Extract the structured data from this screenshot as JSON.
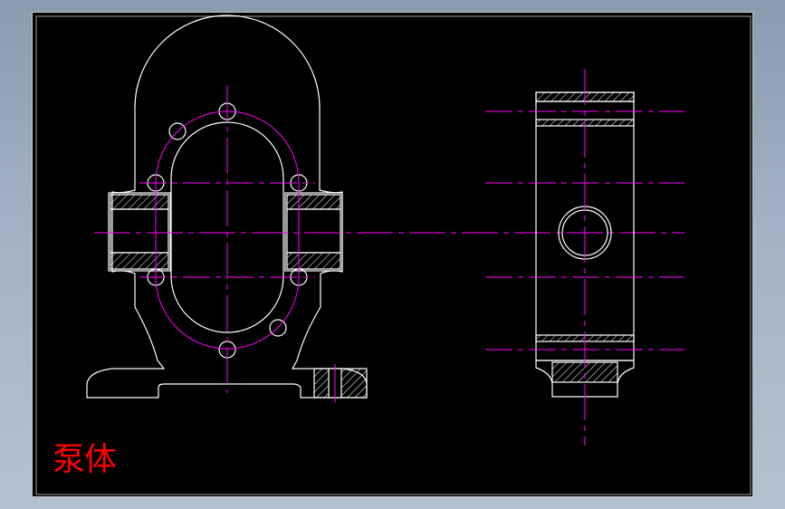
{
  "drawing": {
    "title": "泵体",
    "colors": {
      "background": "#000000",
      "outline": "#ffffff",
      "center_line": "#ff00ff",
      "hatch": "#ffffff",
      "title_text": "#ff0000",
      "frame": "#c8c8c8"
    },
    "views": [
      "front-section-view",
      "side-view"
    ]
  }
}
